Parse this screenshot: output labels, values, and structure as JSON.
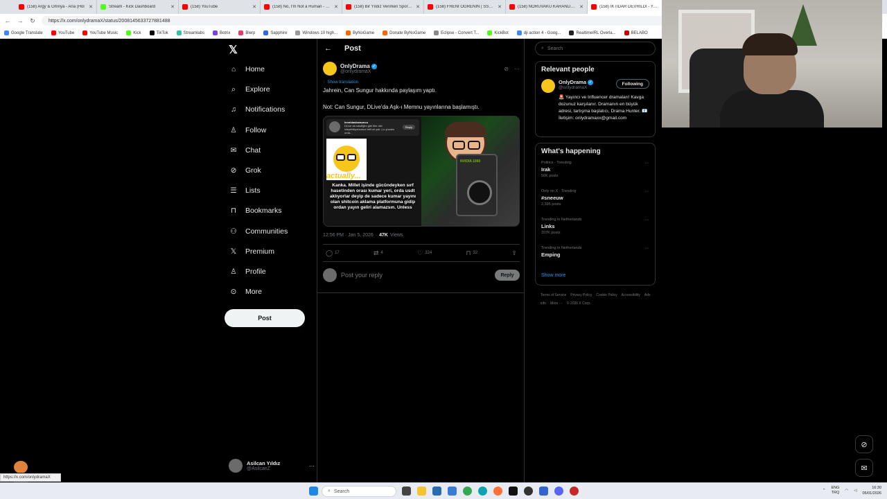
{
  "browser": {
    "tabs": [
      {
        "title": "(158) Argy & Omnya - Aria (Hol",
        "color": "#ff0000",
        "active": false
      },
      {
        "title": "Stream - Kick Dashboard",
        "color": "#53fc18",
        "active": false
      },
      {
        "title": "(158) YouTube",
        "color": "#ff0000",
        "active": false
      },
      {
        "title": "(158) No, I'm Not a Human - Offic",
        "color": "#ff0000",
        "active": false
      },
      {
        "title": "(158) Bir Yıldız Verirken Spor Salonu",
        "color": "#ff0000",
        "active": false
      },
      {
        "title": "(158) FRENİ ÖĞRENİN | SSnider |",
        "color": "#ff0000",
        "active": false
      },
      {
        "title": "(158) NORUVAKU KARANLIK YÜZ",
        "color": "#ff0000",
        "active": false
      },
      {
        "title": "(158) İKTİDAR DEVRİLDİ - YouTu",
        "color": "#ff0000",
        "active": true
      }
    ],
    "url": "https://x.com/onlydramaX/status/2008145633727881488",
    "bookmarks": [
      {
        "label": "Google Translate",
        "color": "#4285f4"
      },
      {
        "label": "YouTube",
        "color": "#ff0000"
      },
      {
        "label": "YouTube Music",
        "color": "#ff0000"
      },
      {
        "label": "Kick",
        "color": "#53fc18"
      },
      {
        "label": "TikTok",
        "color": "#000000"
      },
      {
        "label": "Streamlabs",
        "color": "#31c3a2"
      },
      {
        "label": "Botrix",
        "color": "#7b3fe4"
      },
      {
        "label": "Blerp",
        "color": "#e83b6b"
      },
      {
        "label": "Sapphire",
        "color": "#2d6cdf"
      },
      {
        "label": "Windows 10 high...",
        "color": "#999999"
      },
      {
        "label": "ByNoGame",
        "color": "#ff6600"
      },
      {
        "label": "Donate ByNoGame",
        "color": "#ff6600"
      },
      {
        "label": "Eclipse - Convert T...",
        "color": "#888888"
      },
      {
        "label": "KickBot",
        "color": "#53fc18"
      },
      {
        "label": "dji action 4 - Goog...",
        "color": "#4285f4"
      },
      {
        "label": "RealtimeIRL Overla...",
        "color": "#222222"
      },
      {
        "label": "BELABO",
        "color": "#cc0000"
      }
    ]
  },
  "nav": {
    "items": [
      {
        "label": "Home",
        "icon": "home-icon"
      },
      {
        "label": "Explore",
        "icon": "search-icon"
      },
      {
        "label": "Notifications",
        "icon": "bell-icon"
      },
      {
        "label": "Follow",
        "icon": "person-add-icon"
      },
      {
        "label": "Chat",
        "icon": "mail-icon"
      },
      {
        "label": "Grok",
        "icon": "grok-icon"
      },
      {
        "label": "Lists",
        "icon": "list-icon"
      },
      {
        "label": "Bookmarks",
        "icon": "bookmark-icon"
      },
      {
        "label": "Communities",
        "icon": "people-icon"
      },
      {
        "label": "Premium",
        "icon": "x-logo-icon"
      },
      {
        "label": "Profile",
        "icon": "person-icon"
      },
      {
        "label": "More",
        "icon": "more-circle-icon"
      }
    ],
    "post_button": "Post",
    "account": {
      "name": "Asilcan Yıldız",
      "handle": "@AsilcanZ"
    }
  },
  "main": {
    "header": "Post",
    "tweet": {
      "author": "OnlyDrama",
      "handle": "@onlydramaX",
      "show_translation": "Show translation",
      "text_1": "Jahrein, Can Sungur hakkında paylaşım yaptı.",
      "text_2": "Not: Can Sungur, DLive'da Aşk-ı Memnu yayınlarına başlamıştı.",
      "media": {
        "reply_card_name": "leonidaskarauncu",
        "reply_card_text": "DLive da sdsdiğim gibi film dizi izleyebiliyorsunuz telif ve yok :) o yüzden orda...",
        "reply_card_button": "Reply",
        "actually": "actually...",
        "caption": "Kanka. Millet işinde gücündeyken sırf hasetinden orası kumar yeri, orda usdt aklıyorlar deyip de sadece kumar yayını olan shitcoin aklama platformuna gidip ordan yayın geliri alamazsın. Unless",
        "gpu_label": "NVIDIA 1060"
      },
      "time": "12:56 PM · Jan 5, 2026",
      "views_count": "47K",
      "views_label": "Views",
      "stats": {
        "replies": "17",
        "reposts": "4",
        "likes": "324",
        "bookmarks": "32"
      }
    },
    "reply": {
      "placeholder": "Post your reply",
      "button": "Reply"
    }
  },
  "right": {
    "search_placeholder": "Search",
    "relevant": {
      "title": "Relevant people",
      "name": "OnlyDrama",
      "handle": "@onlydramaX",
      "follow": "Following",
      "bio": "🚨 Yayıncı ve Influencer dramaları! Kavga dozunuz karşılanır. Dramanın en büyük adresi, tartışma başlatıcı, Drama Hunter. 📧 İletişim: onlydramaxx@gmail.com"
    },
    "happening": {
      "title": "What's happening",
      "trends": [
        {
          "category": "Politics · Trending",
          "name": "Irak",
          "count": "50K posts"
        },
        {
          "category": "Only on X · Trending",
          "name": "#sneeuw",
          "count": "2,395 posts"
        },
        {
          "category": "Trending in Netherlands",
          "name": "Links",
          "count": "107K posts"
        },
        {
          "category": "Trending in Netherlands",
          "name": "Emping",
          "count": ""
        }
      ],
      "show_more": "Show more"
    },
    "footer": [
      "Terms of Service",
      "Privacy Policy",
      "Cookie Policy",
      "Accessibility",
      "Ads info",
      "More ···",
      "© 2026 X Corp."
    ]
  },
  "statusbar": {
    "url": "https://x.com/onlydramaX"
  },
  "taskbar": {
    "search": "Search",
    "lang_1": "ENG",
    "lang_2": "TRQ",
    "time": "16:30",
    "date": "05/01/2026"
  },
  "colors": {
    "accent": "#1d9bf0",
    "border": "#2f3336",
    "muted": "#71767b"
  }
}
